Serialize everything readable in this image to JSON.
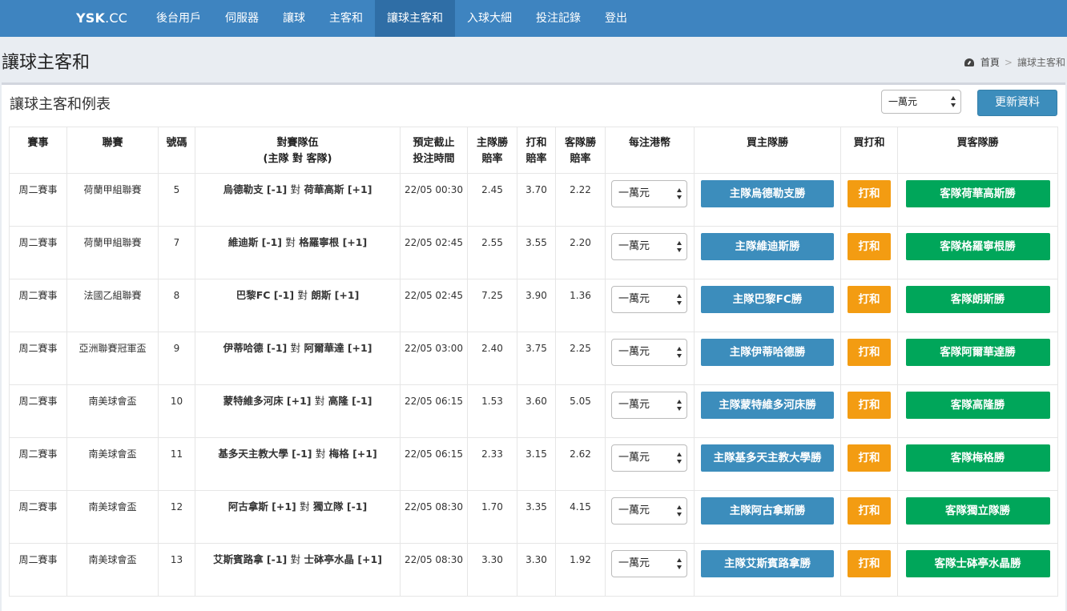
{
  "nav": {
    "brand_bold": "YSK",
    "brand_rest": ".CC",
    "items": [
      {
        "label": "後台用戶",
        "active": false
      },
      {
        "label": "伺服器",
        "active": false
      },
      {
        "label": "讓球",
        "active": false
      },
      {
        "label": "主客和",
        "active": false
      },
      {
        "label": "讓球主客和",
        "active": true
      },
      {
        "label": "入球大細",
        "active": false
      },
      {
        "label": "投注記錄",
        "active": false
      },
      {
        "label": "登出",
        "active": false
      }
    ]
  },
  "page": {
    "title": "讓球主客和",
    "breadcrumb": {
      "home": "首頁",
      "sep": ">",
      "current": "讓球主客和"
    }
  },
  "box": {
    "title": "讓球主客和例表",
    "amount_select": "一萬元",
    "refresh_label": "更新資料"
  },
  "table": {
    "headers": {
      "event": "賽事",
      "league": "聯賽",
      "number": "號碼",
      "teams_line1": "對賽隊伍",
      "teams_line2": "(主隊 對 客隊)",
      "close_line1": "預定截止",
      "close_line2": "投注時間",
      "home_line1": "主隊勝",
      "home_line2": "賠率",
      "draw_line1": "打和",
      "draw_line2": "賠率",
      "away_line1": "客隊勝",
      "away_line2": "賠率",
      "stake": "每注港幣",
      "buy_home": "買主隊勝",
      "buy_draw": "買打和",
      "buy_away": "買客隊勝"
    },
    "vs_word": "對",
    "rows": [
      {
        "event": "周二賽事",
        "league": "荷蘭甲組聯賽",
        "number": "5",
        "home": "烏德勒支 [-1]",
        "away": "荷華高斯 [+1]",
        "close": "22/05 00:30",
        "home_odds": "2.45",
        "draw_odds": "3.70",
        "away_odds": "2.22",
        "stake": "一萬元",
        "buy_home": "主隊烏德勒支勝",
        "buy_draw": "打和",
        "buy_away": "客隊荷華高斯勝"
      },
      {
        "event": "周二賽事",
        "league": "荷蘭甲組聯賽",
        "number": "7",
        "home": "維迪斯 [-1]",
        "away": "格羅寧根 [+1]",
        "close": "22/05 02:45",
        "home_odds": "2.55",
        "draw_odds": "3.55",
        "away_odds": "2.20",
        "stake": "一萬元",
        "buy_home": "主隊維迪斯勝",
        "buy_draw": "打和",
        "buy_away": "客隊格羅寧根勝"
      },
      {
        "event": "周二賽事",
        "league": "法國乙組聯賽",
        "number": "8",
        "home": "巴黎FC [-1]",
        "away": "朗斯 [+1]",
        "close": "22/05 02:45",
        "home_odds": "7.25",
        "draw_odds": "3.90",
        "away_odds": "1.36",
        "stake": "一萬元",
        "buy_home": "主隊巴黎FC勝",
        "buy_draw": "打和",
        "buy_away": "客隊朗斯勝"
      },
      {
        "event": "周二賽事",
        "league": "亞洲聯賽冠軍盃",
        "number": "9",
        "home": "伊蒂哈德 [-1]",
        "away": "阿爾華達 [+1]",
        "close": "22/05 03:00",
        "home_odds": "2.40",
        "draw_odds": "3.75",
        "away_odds": "2.25",
        "stake": "一萬元",
        "buy_home": "主隊伊蒂哈德勝",
        "buy_draw": "打和",
        "buy_away": "客隊阿爾華達勝"
      },
      {
        "event": "周二賽事",
        "league": "南美球會盃",
        "number": "10",
        "home": "蒙特維多河床 [+1]",
        "away": "高隆 [-1]",
        "close": "22/05 06:15",
        "home_odds": "1.53",
        "draw_odds": "3.60",
        "away_odds": "5.05",
        "stake": "一萬元",
        "buy_home": "主隊蒙特維多河床勝",
        "buy_draw": "打和",
        "buy_away": "客隊高隆勝"
      },
      {
        "event": "周二賽事",
        "league": "南美球會盃",
        "number": "11",
        "home": "基多天主教大學 [-1]",
        "away": "梅格 [+1]",
        "close": "22/05 06:15",
        "home_odds": "2.33",
        "draw_odds": "3.15",
        "away_odds": "2.62",
        "stake": "一萬元",
        "buy_home": "主隊基多天主教大學勝",
        "buy_draw": "打和",
        "buy_away": "客隊梅格勝"
      },
      {
        "event": "周二賽事",
        "league": "南美球會盃",
        "number": "12",
        "home": "阿古拿斯 [+1]",
        "away": "獨立隊 [-1]",
        "close": "22/05 08:30",
        "home_odds": "1.70",
        "draw_odds": "3.35",
        "away_odds": "4.15",
        "stake": "一萬元",
        "buy_home": "主隊阿古拿斯勝",
        "buy_draw": "打和",
        "buy_away": "客隊獨立隊勝"
      },
      {
        "event": "周二賽事",
        "league": "南美球會盃",
        "number": "13",
        "home": "艾斯賓路拿 [-1]",
        "away": "士砵亭水晶 [+1]",
        "close": "22/05 08:30",
        "home_odds": "3.30",
        "draw_odds": "3.30",
        "away_odds": "1.92",
        "stake": "一萬元",
        "buy_home": "主隊艾斯賓路拿勝",
        "buy_draw": "打和",
        "buy_away": "客隊士砵亭水晶勝"
      }
    ]
  },
  "colors": {
    "navbar": "#3e84c0",
    "nav_active": "#2f6ea6",
    "home_button": "#3c8dbc",
    "draw_button": "#f39c12",
    "away_button": "#00a65a"
  }
}
